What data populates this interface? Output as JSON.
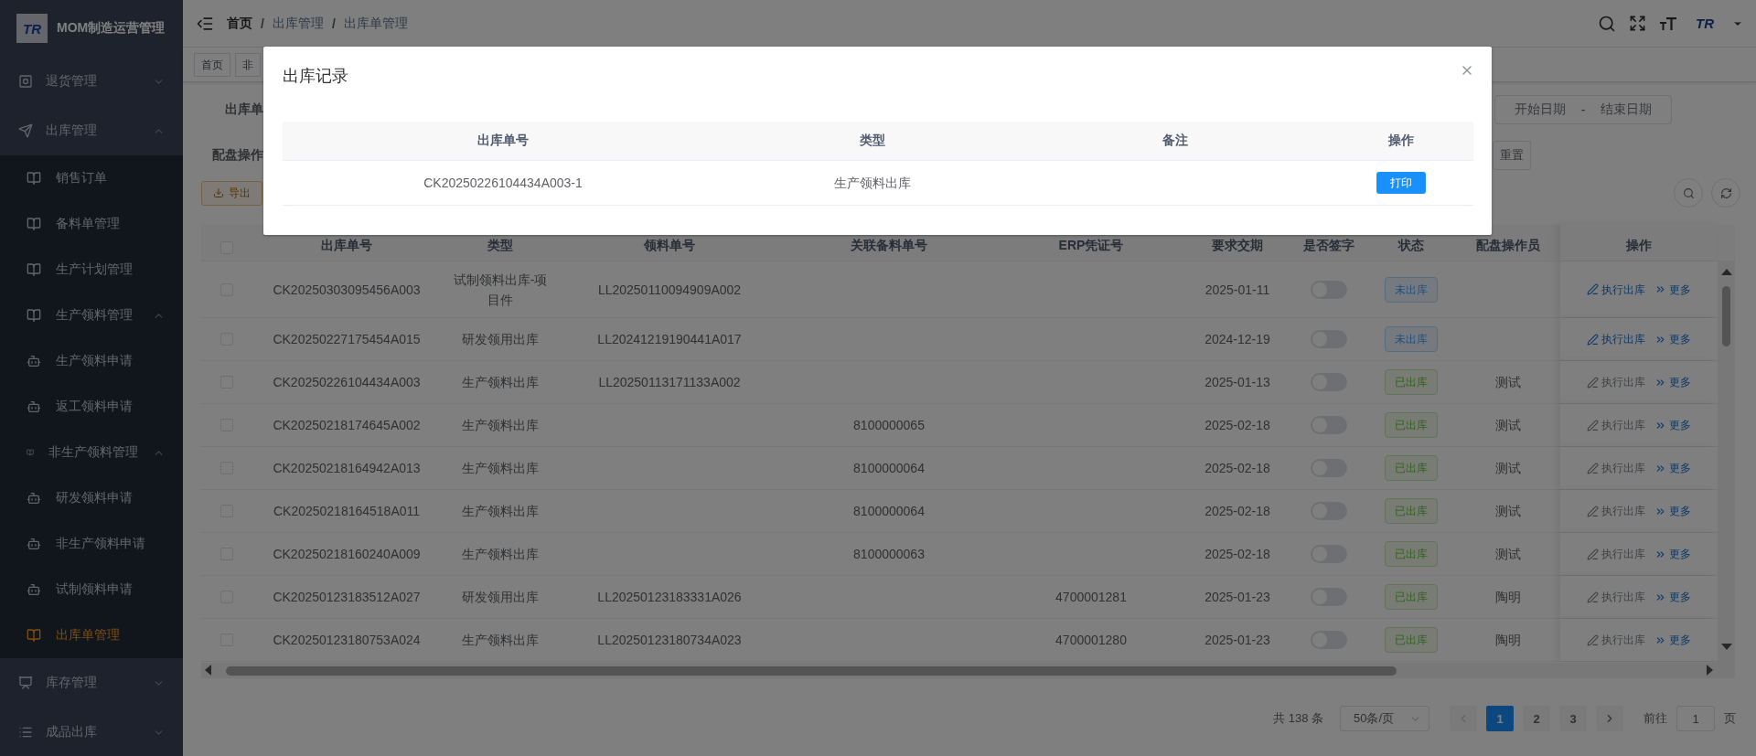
{
  "sidebar": {
    "logo_text": "TR",
    "title": "MOM制造运营管理",
    "menu": [
      {
        "label": "退货管理",
        "expanded": false,
        "selected": false
      },
      {
        "label": "出库管理",
        "expanded": true,
        "selected": false,
        "children": [
          {
            "kind": "page",
            "label": "销售订单",
            "selected": false
          },
          {
            "kind": "page",
            "label": "备料单管理",
            "selected": false
          },
          {
            "kind": "page",
            "label": "生产计划管理",
            "selected": false
          },
          {
            "kind": "page",
            "label": "生产领料管理",
            "expanded": true,
            "selected": false,
            "children": [
              {
                "kind": "form",
                "label": "生产领料申请",
                "selected": false
              },
              {
                "kind": "form",
                "label": "返工领料申请",
                "selected": false
              }
            ]
          },
          {
            "kind": "page",
            "label": "非生产领料管理",
            "expanded": true,
            "selected": false,
            "children": [
              {
                "kind": "form",
                "label": "研发领料申请",
                "selected": false
              },
              {
                "kind": "form",
                "label": "非生产领料申请",
                "selected": false
              },
              {
                "kind": "form",
                "label": "试制领料申请",
                "selected": false
              }
            ]
          },
          {
            "kind": "page",
            "label": "出库单管理",
            "selected": true
          }
        ]
      },
      {
        "label": "库存管理",
        "expanded": false,
        "selected": false
      },
      {
        "label": "成品出库",
        "expanded": false,
        "selected": false
      }
    ]
  },
  "header": {
    "breadcrumb": [
      "首页",
      "出库管理",
      "出库单管理"
    ],
    "separator": "/",
    "avatar_text": "TR"
  },
  "tags": [
    "首页",
    "非"
  ],
  "filters": {
    "labels": [
      "出库单",
      "配盘操作"
    ],
    "date_range": {
      "start_placeholder": "开始日期",
      "separator": "-",
      "end_placeholder": "结束日期"
    },
    "reset_button": "重置",
    "export_button": "导出"
  },
  "table": {
    "header_checked": false,
    "columns": [
      "出库单号",
      "类型",
      "领料单号",
      "关联备料单号",
      "ERP凭证号",
      "要求交期",
      "是否签字",
      "状态",
      "配盘操作员",
      "操作"
    ],
    "rows": [
      {
        "checked": false,
        "order_no": "CK20250303095456A003",
        "type": "试制领料出库-项目件",
        "pick_no": "LL20250110094909A002",
        "due_date": "2025-01-11",
        "signed": false,
        "status": {
          "label": "未出库",
          "kind": "pending"
        },
        "execute": {
          "label": "执行出库",
          "disabled": false
        },
        "more": "更多"
      },
      {
        "checked": false,
        "order_no": "CK20250227175454A015",
        "type": "研发领用出库",
        "pick_no": "LL20241219190441A017",
        "due_date": "2024-12-19",
        "signed": false,
        "status": {
          "label": "未出库",
          "kind": "pending"
        },
        "execute": {
          "label": "执行出库",
          "disabled": false
        },
        "more": "更多"
      },
      {
        "checked": false,
        "order_no": "CK20250226104434A003",
        "type": "生产领料出库",
        "pick_no": "LL20250113171133A002",
        "due_date": "2025-01-13",
        "signed": false,
        "status": {
          "label": "已出库",
          "kind": "done"
        },
        "operator": "测试",
        "execute": {
          "label": "执行出库",
          "disabled": true
        },
        "more": "更多"
      },
      {
        "checked": false,
        "order_no": "CK20250218174645A002",
        "type": "生产领料出库",
        "prep_no": "8100000065",
        "due_date": "2025-02-18",
        "signed": false,
        "status": {
          "label": "已出库",
          "kind": "done"
        },
        "operator": "测试",
        "execute": {
          "label": "执行出库",
          "disabled": true
        },
        "more": "更多"
      },
      {
        "checked": false,
        "order_no": "CK20250218164942A013",
        "type": "生产领料出库",
        "prep_no": "8100000064",
        "due_date": "2025-02-18",
        "signed": false,
        "status": {
          "label": "已出库",
          "kind": "done"
        },
        "operator": "测试",
        "execute": {
          "label": "执行出库",
          "disabled": true
        },
        "more": "更多"
      },
      {
        "checked": false,
        "order_no": "CK20250218164518A011",
        "type": "生产领料出库",
        "prep_no": "8100000064",
        "due_date": "2025-02-18",
        "signed": false,
        "status": {
          "label": "已出库",
          "kind": "done"
        },
        "operator": "测试",
        "execute": {
          "label": "执行出库",
          "disabled": true
        },
        "more": "更多"
      },
      {
        "checked": false,
        "order_no": "CK20250218160240A009",
        "type": "生产领料出库",
        "prep_no": "8100000063",
        "due_date": "2025-02-18",
        "signed": false,
        "status": {
          "label": "已出库",
          "kind": "done"
        },
        "operator": "测试",
        "execute": {
          "label": "执行出库",
          "disabled": true
        },
        "more": "更多"
      },
      {
        "checked": false,
        "order_no": "CK20250123183512A027",
        "type": "研发领用出库",
        "pick_no": "LL20250123183331A026",
        "erp_no": "4700001281",
        "due_date": "2025-01-23",
        "signed": false,
        "status": {
          "label": "已出库",
          "kind": "done"
        },
        "operator": "陶明",
        "execute": {
          "label": "执行出库",
          "disabled": true
        },
        "more": "更多"
      },
      {
        "checked": false,
        "order_no": "CK20250123180753A024",
        "type": "生产领料出库",
        "pick_no": "LL20250123180734A023",
        "erp_no": "4700001280",
        "due_date": "2025-01-23",
        "signed": false,
        "status": {
          "label": "已出库",
          "kind": "done"
        },
        "operator": "陶明",
        "execute": {
          "label": "执行出库",
          "disabled": true
        },
        "more": "更多"
      }
    ]
  },
  "pagination": {
    "total": "共 138 条",
    "page_size": "50条/页",
    "pages": [
      {
        "label": "1",
        "selected": true
      },
      {
        "label": "2",
        "selected": false
      },
      {
        "label": "3",
        "selected": false
      }
    ],
    "goto_label": "前往",
    "goto_value": "1",
    "goto_suffix": "页"
  },
  "modal": {
    "title": "出库记录",
    "columns": [
      "出库单号",
      "类型",
      "备注",
      "操作"
    ],
    "rows": [
      {
        "order_no": "CK20250226104434A003-1",
        "type": "生产领料出库",
        "action": "打印"
      }
    ]
  }
}
